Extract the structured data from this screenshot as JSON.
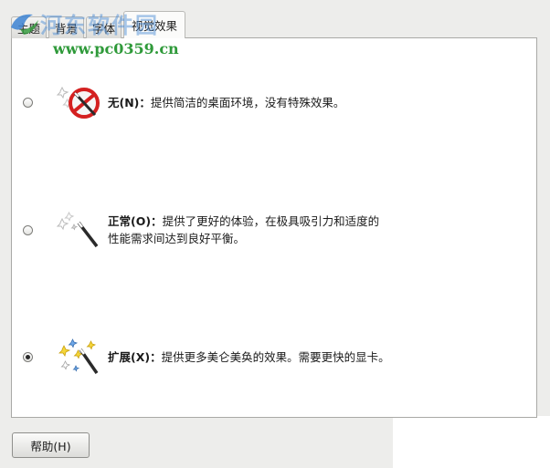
{
  "tabs": [
    {
      "label": "主题"
    },
    {
      "label": "背景"
    },
    {
      "label": "字体"
    },
    {
      "label": "视觉效果"
    }
  ],
  "active_tab": "视觉效果",
  "options": [
    {
      "title": "无(N)：",
      "description": "提供简洁的桌面环境，没有特殊效果。",
      "selected": false,
      "icon": "no-effects-icon"
    },
    {
      "title": "正常(O)：",
      "description_line1": "提供了更好的体验，在极具吸引力和适度的",
      "description_line2": "性能需求间达到良好平衡。",
      "selected": false,
      "icon": "magic-wand-icon"
    },
    {
      "title": "扩展(X)：",
      "description": "提供更多美仑美奂的效果。需要更快的显卡。",
      "selected": true,
      "icon": "sparkle-wand-icon"
    }
  ],
  "help_button": {
    "label": "帮助(H)"
  },
  "watermark": {
    "title": "河东软件园",
    "url": "www.pc0359.cn"
  },
  "colors": {
    "panel_bg": "#ffffff",
    "window_bg": "#ededeb",
    "border": "#a9a9a6",
    "watermark_green": "#2f9a3a",
    "watermark_blue": "#3c82d2"
  }
}
